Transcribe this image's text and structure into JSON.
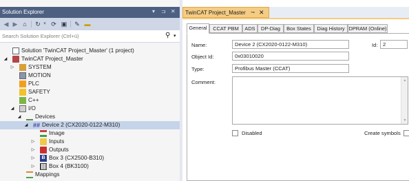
{
  "solution_explorer": {
    "title": "Solution Explorer",
    "title_controls": [
      "▾",
      "⊐",
      "✕"
    ],
    "toolbar_icons": [
      "back-icon",
      "forward-icon",
      "home-icon",
      "sync-icon",
      "dropdown-icon",
      "refresh-icon",
      "collapse-icon",
      "properties-icon",
      "pin-icon"
    ],
    "search_placeholder": "Search Solution Explorer (Ctrl+ü)",
    "tree": [
      {
        "label": "Solution 'TwinCAT Project_Master' (1 project)"
      },
      {
        "label": "TwinCAT Project_Master"
      },
      {
        "label": "SYSTEM"
      },
      {
        "label": "MOTION"
      },
      {
        "label": "PLC"
      },
      {
        "label": "SAFETY"
      },
      {
        "label": "C++"
      },
      {
        "label": "I/O"
      },
      {
        "label": "Devices"
      },
      {
        "label": "Device 2 (CX2020-0122-M310)"
      },
      {
        "label": "Image"
      },
      {
        "label": "Inputs"
      },
      {
        "label": "Outputs"
      },
      {
        "label": "Box 3 (CX2500-B310)"
      },
      {
        "label": "Box 4 (BK3100)"
      },
      {
        "label": "Mappings"
      }
    ]
  },
  "document": {
    "tab_title": "TwinCAT Project_Master",
    "inner_tabs": [
      "General",
      "CCAT PBM",
      "ADS",
      "DP-Diag",
      "Box States",
      "Diag History",
      "DPRAM (Online)"
    ],
    "active_tab": "General",
    "form": {
      "name_label": "Name:",
      "name_value": "Device 2 (CX2020-0122-M310)",
      "id_label": "Id:",
      "id_value": "2",
      "object_id_label": "Object Id:",
      "object_id_value": "0x03010020",
      "type_label": "Type:",
      "type_value": "Profibus Master (CCAT)",
      "comment_label": "Comment:",
      "comment_value": "",
      "disabled_label": "Disabled",
      "disabled_checked": false,
      "create_symbols_label": "Create symbols",
      "create_symbols_checked": false
    }
  },
  "colors": {
    "title_bar": "#4d6082",
    "toolbar": "#cfd6e5",
    "selected_row": "#c6d4ea",
    "document_tab": "#f5cc84"
  }
}
